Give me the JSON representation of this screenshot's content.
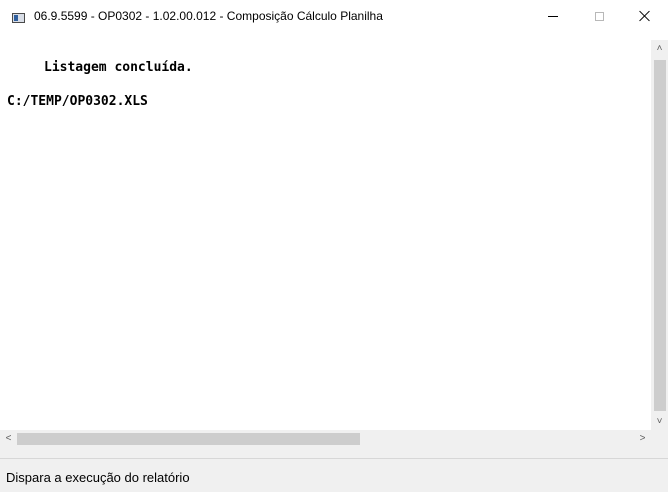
{
  "window": {
    "title": "06.9.5599 - OP0302 - 1.02.00.012 - Composição Cálculo Planilha",
    "minimize_glyph": "",
    "close_label": ""
  },
  "content": {
    "lines": [
      "Listagem concluída.",
      "C:/TEMP/OP0302.XLS"
    ]
  },
  "scrollbars": {
    "up_arrow": "˄",
    "down_arrow": "˅",
    "left_arrow": "<",
    "right_arrow": ">"
  },
  "statusbar": {
    "text": "Dispara a execução do relatório"
  },
  "icons": {
    "app": "app-window-icon",
    "minimize": "minimize-icon",
    "maximize": "maximize-icon",
    "close": "close-icon"
  }
}
